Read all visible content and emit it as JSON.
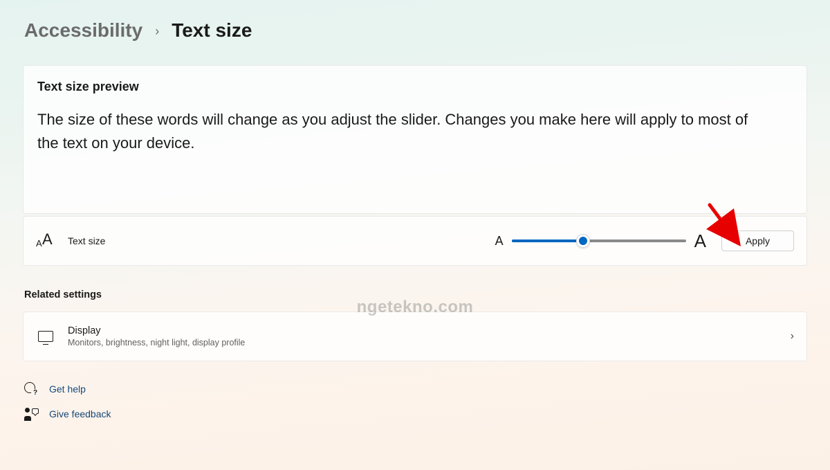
{
  "breadcrumb": {
    "parent": "Accessibility",
    "separator": "›",
    "current": "Text size"
  },
  "preview": {
    "title": "Text size preview",
    "body": "The size of these words will change as you adjust the slider. Changes you make here will apply to most of the text on your device."
  },
  "slider": {
    "label": "Text size",
    "min_glyph": "A",
    "max_glyph": "A",
    "value_percent": 41,
    "apply_label": "Apply"
  },
  "related": {
    "heading": "Related settings",
    "display": {
      "title": "Display",
      "subtitle": "Monitors, brightness, night light, display profile"
    }
  },
  "footer": {
    "help": "Get help",
    "feedback": "Give feedback"
  },
  "watermark": "ngetekno.com",
  "colors": {
    "accent": "#0067c0",
    "link": "#15487c"
  }
}
